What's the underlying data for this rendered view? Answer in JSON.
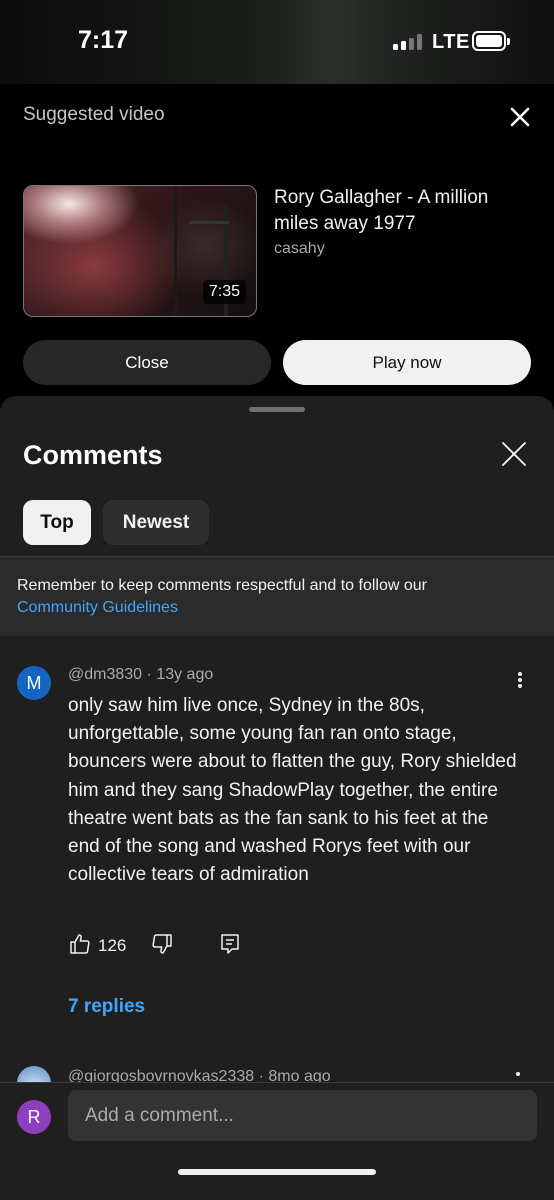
{
  "status_bar": {
    "time": "7:17",
    "network": "LTE",
    "icons": [
      "signal-icon",
      "battery-icon"
    ]
  },
  "suggested": {
    "label": "Suggested video",
    "close_icon": "close-icon",
    "video": {
      "title": "Rory Gallagher - A million miles away 1977",
      "channel": "casahy",
      "duration": "7:35"
    },
    "close_button": "Close",
    "play_button": "Play now"
  },
  "comments": {
    "title": "Comments",
    "close_icon": "close-icon",
    "chips": [
      "Top",
      "Newest"
    ],
    "notice_text": "Remember to keep comments respectful and to follow our",
    "notice_link": "Community Guidelines",
    "items": [
      {
        "avatar_letter": "M",
        "author": "@dm3830",
        "age": "13y ago",
        "text": "only saw him live once, Sydney in the 80s, unforgettable, some young fan ran onto stage, bouncers were about to flatten the guy, Rory shielded him and they sang ShadowPlay together, the entire theatre went bats as the fan sank to his feet at the end of the song and washed Rorys feet with our collective tears of admiration",
        "likes": "126",
        "replies": "7 replies"
      },
      {
        "author": "@giorgosbovrnovkas2338",
        "age": "8mo ago"
      }
    ],
    "composer": {
      "avatar_letter": "R",
      "placeholder": "Add a comment..."
    }
  },
  "colors": {
    "accent_link": "#3ea6ff",
    "sheet_bg": "#1f1f1f",
    "avatar_m": "#1565c0",
    "avatar_r": "#8e3fbf"
  }
}
